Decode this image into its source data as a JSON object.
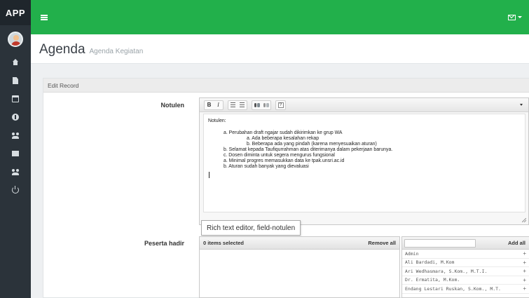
{
  "brand": "APP",
  "colors": {
    "accent": "#22b04b",
    "sidebar": "#2b333a"
  },
  "sidebar": {
    "items": [
      {
        "icon": "home-icon"
      },
      {
        "icon": "file-icon"
      },
      {
        "icon": "calendar-icon"
      },
      {
        "icon": "info-icon"
      },
      {
        "icon": "users-icon"
      },
      {
        "icon": "mail-icon"
      },
      {
        "icon": "users-icon"
      },
      {
        "icon": "power-icon"
      }
    ]
  },
  "header": {
    "title": "Agenda",
    "subtitle": "Agenda Kegiatan"
  },
  "panel": {
    "heading": "Edit Record"
  },
  "form": {
    "notulen_label": "Notulen",
    "peserta_label": "Peserta hadir"
  },
  "editor": {
    "toolbar": [
      "bold",
      "italic",
      "numbered-list",
      "bulleted-list",
      "find",
      "replace",
      "help"
    ],
    "content": {
      "lead": "Notulen:",
      "lines": [
        {
          "level": 1,
          "text": "a. Perubahan draft ngajar sudah dikirimkan ke grup WA"
        },
        {
          "level": 2,
          "text": "a. Ada beberapa kesalahan rekap"
        },
        {
          "level": 2,
          "text": "b. Beberapa ada yang pindah (karena menyesuaikan aturan)"
        },
        {
          "level": 1,
          "text": "b. Selamat kepada Taufiqurrahman atas diterimanya dalam pekerjaan barunya."
        },
        {
          "level": 1,
          "text": "c. Dosen diminta untuk segera mengurus fungsional"
        },
        {
          "level": 1,
          "text": "a. Minimal progres memasukkan data ke tpak.unsri.ac.id"
        },
        {
          "level": 1,
          "text": "b. Aturan sudah banyak yang dievaluasi"
        }
      ]
    },
    "tooltip": "Rich text editor, field-notulen"
  },
  "multiselect": {
    "selected_count": "0 items selected",
    "remove_all": "Remove all",
    "add_all": "Add all",
    "search_placeholder": "",
    "available": [
      "Admin",
      "Ali Bardadi, M.Kom",
      "Ari Wedhasmara, S.Kom., M.T.I.",
      "Dr. Ermatita, M.Kom.",
      "Endang Lestari Ruskan, S.Kom., M.T."
    ]
  }
}
